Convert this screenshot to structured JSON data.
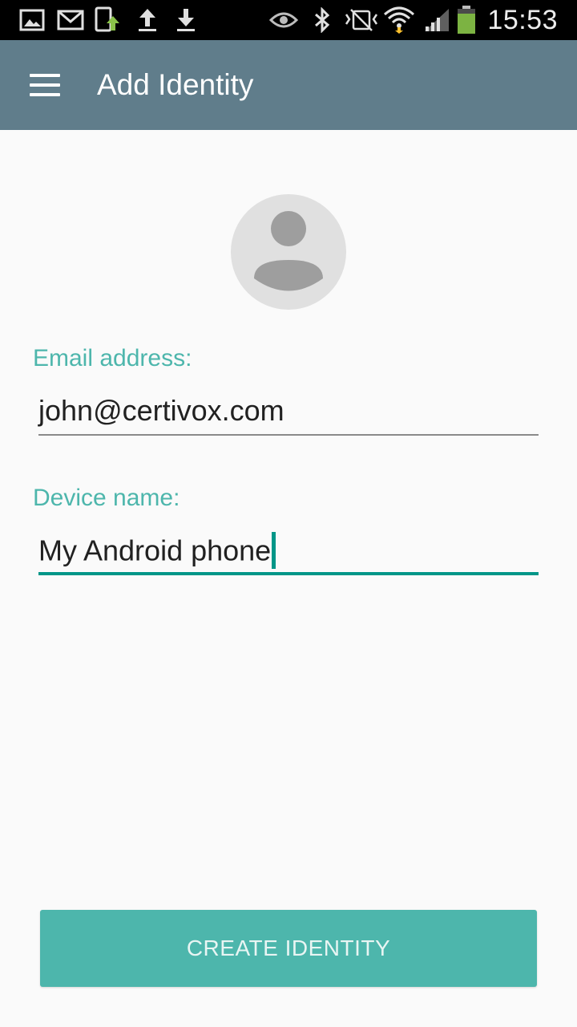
{
  "status_bar": {
    "time": "15:53",
    "left_icons": [
      "gallery-icon",
      "gmail-icon",
      "device-update-icon",
      "upload-icon",
      "download-icon"
    ],
    "right_icons": [
      "eye-icon",
      "bluetooth-icon",
      "no-sound-icon",
      "wifi-icon",
      "signal-icon",
      "battery-icon"
    ],
    "battery_color": "#7cb342"
  },
  "app_bar": {
    "title": "Add Identity",
    "background": "#607d8b",
    "menu_icon": "hamburger-menu-icon"
  },
  "avatar": {
    "icon": "person-avatar-icon"
  },
  "form": {
    "email_label": "Email address:",
    "email_value": "john@certivox.com",
    "device_label": "Device name:",
    "device_value": "My Android phone",
    "accent_color": "#4db6ac",
    "focus_color": "#009688"
  },
  "actions": {
    "create_label": "CREATE IDENTITY"
  }
}
